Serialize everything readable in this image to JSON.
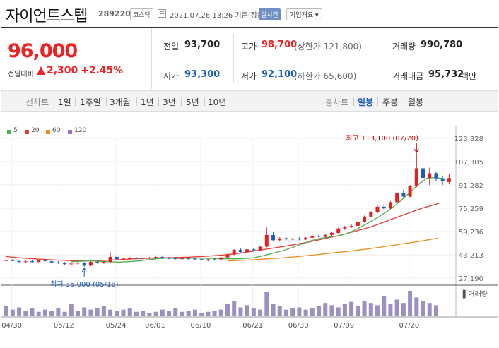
{
  "header": {
    "title": "자이언트스텝",
    "code": "289220",
    "market": "코스닥",
    "datetime": "2021.07.26 13:26 기준(장중)",
    "realtime_label": "실시간",
    "company_label": "기업개요 ▾"
  },
  "price": {
    "current": "96,000",
    "change_label": "전일대비",
    "change_amount": "2,300",
    "change_rate": "+2.45%",
    "colors": {
      "up": "#e22222",
      "down": "#1d5fb8"
    }
  },
  "stats": {
    "prev_label": "전일",
    "prev_value": "93,700",
    "high_label": "고가",
    "high_value": "98,700",
    "high_sub": "(상한가 121,800)",
    "volume_label": "거래량",
    "volume_value": "990,780",
    "open_label": "시가",
    "open_value": "93,300",
    "low_label": "저가",
    "low_value": "92,100",
    "low_sub": "(하한가 65,600)",
    "amount_label": "거래대금",
    "amount_value": "95,732",
    "amount_unit": "백만"
  },
  "tabs": {
    "line_chart": "선차트",
    "periods": [
      "1일",
      "1주일",
      "3개월",
      "1년",
      "3년",
      "5년",
      "10년"
    ],
    "candle_chart": "봉차트",
    "candles": [
      "일봉",
      "주봉",
      "월봉"
    ],
    "active_candle": "일봉"
  },
  "chart_data": {
    "type": "candlestick",
    "legend": [
      {
        "name": "5",
        "color": "#4caf50"
      },
      {
        "name": "20",
        "color": "#e53935"
      },
      {
        "name": "60",
        "color": "#f08c1a"
      },
      {
        "name": "120",
        "color": "#9c6fc7"
      }
    ],
    "y_ticks": [
      "123,328",
      "107,305",
      "91,282",
      "75,259",
      "59,236",
      "43,213",
      "27,190"
    ],
    "ylim": [
      27190,
      123328
    ],
    "x_ticks": [
      "04/30",
      "05/12",
      "05/24",
      "06/01",
      "06/10",
      "06/21",
      "06/30",
      "07/09",
      "07/20"
    ],
    "annotations": {
      "high": "최고 113,100 (07/20)",
      "low": "최저 35,000 (05/18)"
    },
    "volume_label": "거래량",
    "candles": [
      [
        39500,
        40500,
        38500,
        39500
      ],
      [
        39800,
        40300,
        38800,
        39000
      ],
      [
        38800,
        39500,
        37900,
        38500
      ],
      [
        38500,
        39300,
        37800,
        38700
      ],
      [
        38800,
        39600,
        38000,
        38200
      ],
      [
        38300,
        39800,
        38000,
        39400
      ],
      [
        39400,
        40000,
        38400,
        38900
      ],
      [
        38800,
        39200,
        37800,
        38000
      ],
      [
        38000,
        38800,
        37000,
        37500
      ],
      [
        37500,
        38200,
        36000,
        36800
      ],
      [
        36800,
        37600,
        35600,
        37200
      ],
      [
        37200,
        38400,
        36500,
        37700
      ],
      [
        37600,
        38200,
        35000,
        35800
      ],
      [
        35800,
        39000,
        35500,
        38300
      ],
      [
        38300,
        38800,
        37200,
        37600
      ],
      [
        37500,
        38600,
        37000,
        38300
      ],
      [
        38300,
        45000,
        37500,
        41800
      ],
      [
        41800,
        42900,
        39800,
        40200
      ],
      [
        40300,
        41200,
        39300,
        40600
      ],
      [
        40600,
        41600,
        39900,
        40900
      ],
      [
        41000,
        41500,
        40100,
        40600
      ],
      [
        40600,
        41300,
        39800,
        41000
      ],
      [
        41000,
        41800,
        40400,
        41300
      ],
      [
        41300,
        42100,
        40500,
        41700
      ],
      [
        41700,
        42200,
        40700,
        41100
      ],
      [
        41100,
        41700,
        40200,
        40800
      ],
      [
        40800,
        41400,
        39900,
        40300
      ],
      [
        40300,
        41100,
        39500,
        40700
      ],
      [
        40700,
        41300,
        40000,
        40500
      ],
      [
        40500,
        41000,
        39700,
        40200
      ],
      [
        40200,
        40800,
        39500,
        39800
      ],
      [
        39800,
        40400,
        38900,
        40100
      ],
      [
        40100,
        41000,
        39300,
        40000
      ],
      [
        40000,
        41700,
        39500,
        41400
      ],
      [
        41400,
        43800,
        41000,
        43400
      ],
      [
        43400,
        47100,
        43000,
        46600
      ],
      [
        46600,
        47600,
        44700,
        45200
      ],
      [
        45200,
        47500,
        44400,
        47000
      ],
      [
        47000,
        48000,
        45800,
        46300
      ],
      [
        46400,
        49400,
        45900,
        48800
      ],
      [
        48800,
        62000,
        48300,
        56800
      ],
      [
        56800,
        58800,
        52800,
        53300
      ],
      [
        53300,
        55300,
        52300,
        54500
      ],
      [
        54600,
        55600,
        53100,
        53800
      ],
      [
        53800,
        55100,
        52900,
        54200
      ],
      [
        54300,
        55300,
        53200,
        53800
      ],
      [
        53800,
        55400,
        53300,
        55000
      ],
      [
        55000,
        56500,
        54600,
        56100
      ],
      [
        56100,
        57200,
        55100,
        55600
      ],
      [
        55600,
        57300,
        55200,
        56900
      ],
      [
        56900,
        58700,
        56300,
        58300
      ],
      [
        58300,
        61800,
        57800,
        61300
      ],
      [
        61300,
        63200,
        60300,
        62600
      ],
      [
        62600,
        64100,
        61600,
        63100
      ],
      [
        63100,
        66300,
        62700,
        65800
      ],
      [
        65800,
        70200,
        65300,
        69500
      ],
      [
        69500,
        73200,
        68900,
        72600
      ],
      [
        72600,
        77100,
        71800,
        76300
      ],
      [
        76300,
        78200,
        74400,
        75100
      ],
      [
        75100,
        80100,
        74600,
        79400
      ],
      [
        79400,
        86600,
        78900,
        85700
      ],
      [
        85700,
        88100,
        82600,
        83300
      ],
      [
        83300,
        91200,
        82700,
        90500
      ],
      [
        90500,
        113100,
        89600,
        102700
      ],
      [
        102700,
        108700,
        95600,
        96100
      ],
      [
        96100,
        103200,
        91200,
        99300
      ],
      [
        99300,
        100600,
        94200,
        95800
      ],
      [
        95800,
        97100,
        91300,
        93700
      ],
      [
        93300,
        98700,
        92100,
        96000
      ]
    ],
    "ma5": [
      38500,
      38800,
      39100,
      38700,
      38400,
      38200,
      38500,
      39000,
      39800,
      40500,
      41000,
      40800,
      40900,
      41000,
      40800,
      40600,
      40500,
      40400,
      40600,
      41200,
      42600,
      44400,
      46000,
      48200,
      50700,
      53000,
      54600,
      55600,
      56500,
      58600,
      61900,
      65500,
      69300,
      73600,
      78800,
      84600,
      90900,
      95900,
      96400,
      95200
    ],
    "ma20": [
      42000,
      41000,
      40200,
      39600,
      39200,
      39100,
      39400,
      40000,
      40600,
      41000,
      41300,
      41600,
      42200,
      43000,
      44300,
      46000,
      47800,
      49600,
      51600,
      54000,
      56500,
      59500,
      62800,
      67000,
      71200,
      75300,
      78600
    ],
    "ma60": [
      39000,
      39500,
      40200,
      41000,
      42000,
      43200,
      44500,
      45800,
      47300,
      49000,
      50800,
      52600,
      54700
    ],
    "volumes": [
      0.9,
      0.6,
      0.8,
      0.5,
      0.7,
      0.4,
      0.6,
      0.5,
      0.7,
      0.4,
      1.1,
      0.5,
      0.8,
      0.6,
      0.7,
      0.9,
      0.6,
      0.5,
      0.6,
      0.7,
      0.4,
      0.5,
      0.3,
      0.4,
      0.6,
      0.5,
      0.7,
      0.4,
      0.5,
      0.6,
      0.3,
      0.4,
      0.5,
      0.6,
      1.1,
      1.4,
      0.8,
      1.0,
      0.7,
      0.6,
      2.2,
      1.1,
      0.9,
      0.6,
      0.7,
      0.8,
      0.6,
      0.7,
      0.9,
      1.2,
      1.0,
      0.8,
      1.1,
      1.3,
      0.9,
      1.4,
      1.2,
      1.0,
      1.8,
      1.1,
      1.5,
      1.2,
      2.3,
      1.7,
      1.4,
      1.2,
      1.0
    ]
  }
}
